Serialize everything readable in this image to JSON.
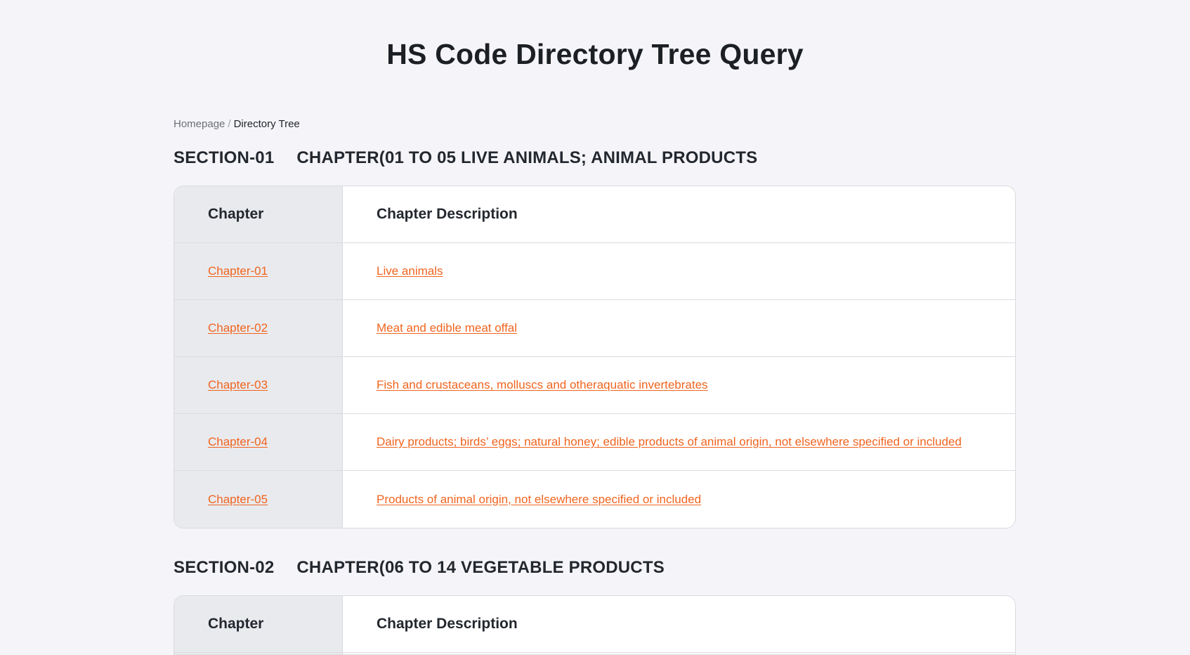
{
  "page": {
    "title": "HS Code Directory Tree Query"
  },
  "breadcrumb": {
    "home": "Homepage",
    "separator": "/",
    "current": "Directory Tree"
  },
  "table_headers": {
    "chapter": "Chapter",
    "description": "Chapter Description"
  },
  "sections": [
    {
      "code": "SECTION-01",
      "title": "CHAPTER(01 TO 05 LIVE ANIMALS; ANIMAL PRODUCTS",
      "chapters": [
        {
          "chapter": "Chapter-01",
          "description": "Live animals"
        },
        {
          "chapter": "Chapter-02",
          "description": "Meat and edible meat offal"
        },
        {
          "chapter": "Chapter-03",
          "description": "Fish and crustaceans, molluscs and otheraquatic invertebrates"
        },
        {
          "chapter": "Chapter-04",
          "description": "Dairy products; birds’ eggs; natural honey; edible products of animal origin, not elsewhere specified or included"
        },
        {
          "chapter": "Chapter-05",
          "description": "Products of animal origin, not elsewhere specified or included"
        }
      ]
    },
    {
      "code": "SECTION-02",
      "title": "CHAPTER(06 TO 14 VEGETABLE PRODUCTS",
      "chapters": []
    }
  ],
  "colors": {
    "link": "#f0641e",
    "background": "#f5f5f9",
    "chapter_column_bg": "#e9eaee",
    "border": "#d9dbe0"
  }
}
